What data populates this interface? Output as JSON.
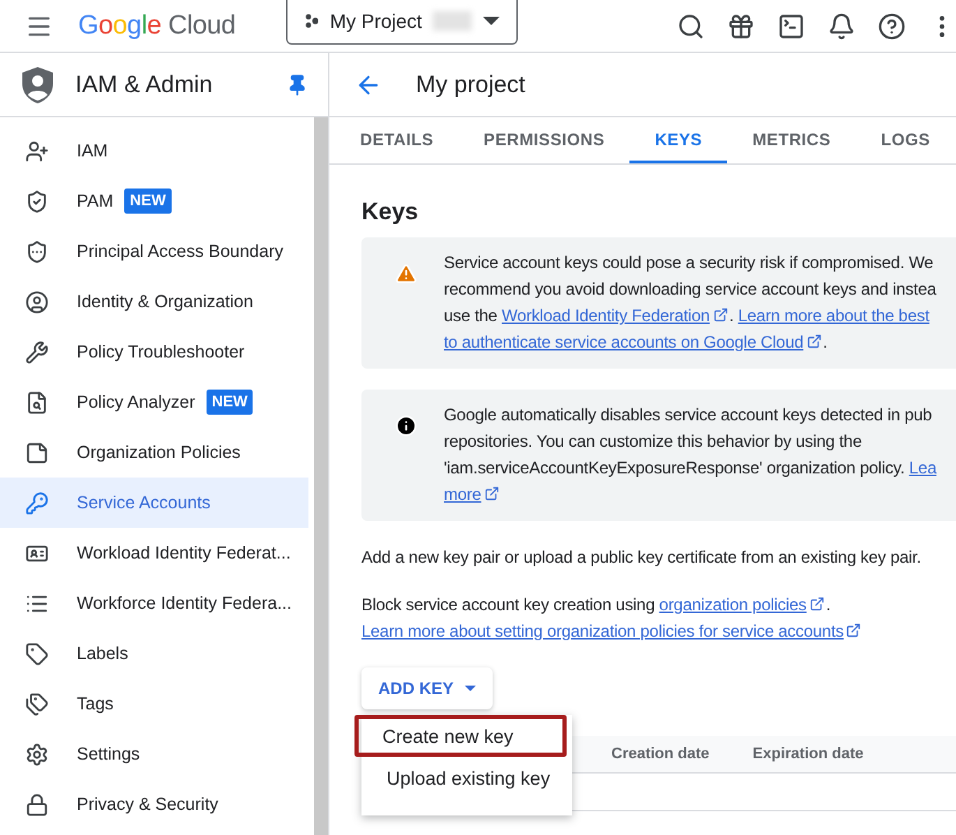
{
  "topbar": {
    "logo": "Google Cloud",
    "project": "My Project"
  },
  "sidebar": {
    "title": "IAM & Admin",
    "pinned": true,
    "items": [
      {
        "label": "IAM",
        "selected": false
      },
      {
        "label": "PAM",
        "badge": "NEW",
        "selected": false
      },
      {
        "label": "Principal Access Boundary",
        "selected": false
      },
      {
        "label": "Identity & Organization",
        "selected": false
      },
      {
        "label": "Policy Troubleshooter",
        "selected": false
      },
      {
        "label": "Policy Analyzer",
        "badge": "NEW",
        "selected": false
      },
      {
        "label": "Organization Policies",
        "selected": false
      },
      {
        "label": "Service Accounts",
        "selected": true
      },
      {
        "label": "Workload Identity Federat...",
        "selected": false
      },
      {
        "label": "Workforce Identity Federa...",
        "selected": false
      },
      {
        "label": "Labels",
        "selected": false
      },
      {
        "label": "Tags",
        "selected": false
      },
      {
        "label": "Settings",
        "selected": false
      },
      {
        "label": "Privacy & Security",
        "selected": false
      }
    ]
  },
  "page": {
    "title": "My project",
    "tabs": [
      {
        "label": "DETAILS",
        "selected": false
      },
      {
        "label": "PERMISSIONS",
        "selected": false
      },
      {
        "label": "KEYS",
        "selected": true
      },
      {
        "label": "METRICS",
        "selected": false
      },
      {
        "label": "LOGS",
        "selected": false
      }
    ],
    "heading": "Keys",
    "alerts": [
      {
        "kind": "warning",
        "lines": [
          [
            {
              "kind": "text",
              "text": "Service account keys could pose a security risk if compromised. We"
            }
          ],
          [
            {
              "kind": "text",
              "text": "recommend you avoid downloading service account keys and instea"
            }
          ],
          [
            {
              "kind": "text",
              "text": "use the "
            },
            {
              "kind": "link",
              "text": "Workload Identity Federation",
              "external": true,
              "after": ". "
            },
            {
              "kind": "link",
              "text": "Learn more about the best",
              "external": false
            }
          ],
          [
            {
              "kind": "link",
              "text": "to authenticate service accounts on Google Cloud",
              "external": true,
              "after": "."
            }
          ]
        ]
      },
      {
        "kind": "info",
        "lines": [
          [
            {
              "kind": "text",
              "text": "Google automatically disables service account keys detected in pub"
            }
          ],
          [
            {
              "kind": "text",
              "text": "repositories. You can customize this behavior by using the"
            }
          ],
          [
            {
              "kind": "text",
              "text": "'iam.serviceAccountKeyExposureResponse' organization policy. "
            },
            {
              "kind": "link",
              "text": "Lea",
              "external": false
            }
          ],
          [
            {
              "kind": "link",
              "text": "more",
              "external": true
            }
          ]
        ]
      }
    ],
    "description": "Add a new key pair or upload a public key certificate from an existing key pair.",
    "block_text": "Block service account key creation using ",
    "block_link": "organization policies",
    "block_end": ".",
    "learn_link": "Learn more about setting organization policies for service accounts",
    "add_key": "ADD KEY",
    "menu": [
      {
        "label": "Create new key",
        "selected": true
      },
      {
        "label": "Upload existing key",
        "selected": false
      }
    ],
    "table": {
      "columns": [
        "Creation date",
        "Expiration date"
      ]
    }
  }
}
